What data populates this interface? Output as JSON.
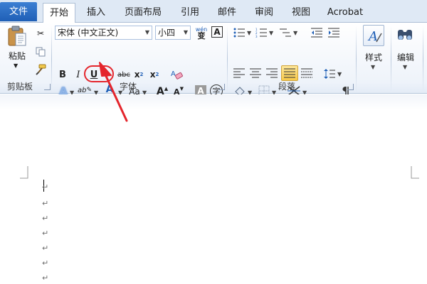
{
  "tabs": {
    "file": "文件",
    "home": "开始",
    "insert": "插入",
    "layout": "页面布局",
    "references": "引用",
    "mailings": "邮件",
    "review": "审阅",
    "view": "视图",
    "acrobat": "Acrobat"
  },
  "clipboard": {
    "paste_label": "粘贴",
    "group_label": "剪贴板"
  },
  "font": {
    "font_name": "宋体 (中文正文)",
    "font_size": "小四",
    "wen_glyph": "wén",
    "wen_char": "变",
    "bold": "B",
    "italic": "I",
    "underline": "U",
    "strike": "abc",
    "subscript": "x",
    "subscript_mark": "2",
    "superscript": "x",
    "superscript_mark": "2",
    "text_effects": "A",
    "highlight": "ab",
    "font_color": "A",
    "change_case": "Aa",
    "grow": "A",
    "shrink": "A",
    "char_shading": "A",
    "enclose": "字",
    "border_char": "A",
    "group_label": "字体"
  },
  "paragraph": {
    "group_label": "段落"
  },
  "styles": {
    "label": "样式"
  },
  "editing": {
    "label": "编辑"
  },
  "document": {
    "paragraph_mark": "↵",
    "visible_marks": 7
  },
  "colors": {
    "annotation": "#e4252c",
    "file_tab": "#2a6cc6",
    "highlight_yellow": "#ffff00",
    "font_red": "#e00000"
  }
}
